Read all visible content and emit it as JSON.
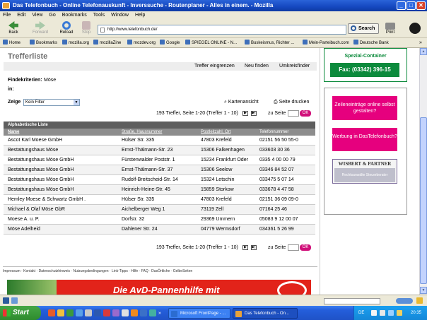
{
  "window": {
    "title": "Das Telefonbuch - Online Telefonauskunft - Inverssuche - Routenplaner - Alles in einem. - Mozilla",
    "min": "_",
    "max": "□",
    "close": "✕"
  },
  "menu": [
    "File",
    "Edit",
    "View",
    "Go",
    "Bookmarks",
    "Tools",
    "Window",
    "Help"
  ],
  "toolbar": {
    "back": "Back",
    "forward": "Forward",
    "reload": "Reload",
    "stop": "Stop",
    "url": "http://www.telefonbuch.de/",
    "search": "Search",
    "print": "Print"
  },
  "bookmarks": [
    "Home",
    "Bookmarks",
    "mozilla.org",
    "mozillaZine",
    "mozdev.org",
    "Google",
    "SPIEGEL ONLINE - N...",
    "Buskeismus, Richter ...",
    "Mein-Parteibuch.com",
    "Deutsche Bank"
  ],
  "page": {
    "heading": "Trefferliste",
    "actions": [
      "Treffer eingrenzen",
      "Neu finden",
      "Umkreisfinder"
    ],
    "criteria_label": "Findekriterien:",
    "criteria_value": "Möse",
    "criteria_in": "in:",
    "zeige_label": "Zeige",
    "filter_value": "Kein Filter",
    "map_view": "Kartenansicht",
    "print_page": "Seite drucken",
    "pager_top": "193 Treffer, Seite 1-20 (Treffer 1 - 10)",
    "pager_bottom": "193 Treffer, Seite 1-20 (Treffer 1 - 10)",
    "goto_label": "zu Seite",
    "ok": "OK",
    "list_title": "Alphabetische Liste",
    "columns": [
      "Name",
      "Straße, Hausnummer",
      "Postleitzahl, Ort",
      "Telefonnummer"
    ],
    "rows": [
      [
        "Ascot Karl Moese GmbH",
        "Hülser Str. 335",
        "47803 Krefeld",
        "02151 56 50 55-0"
      ],
      [
        "Bestattungshaus Möse",
        "Ernst-Thälmann-Str. 23",
        "15306 Falkenhagen",
        "033603 30 36"
      ],
      [
        "Bestattungshaus Möse GmbH",
        "Fürstenwalder Poststr. 1",
        "15234 Frankfurt Oder",
        "0335 4 00 00 79"
      ],
      [
        "Bestattungshaus Möse GmbH",
        "Ernst-Thälmann-Str. 37",
        "15306 Seelow",
        "03346 84 52 07"
      ],
      [
        "Bestattungshaus Möse GmbH",
        "Rudolf-Breitscheid-Str. 14",
        "15324 Letschin",
        "033475 5 07 14"
      ],
      [
        "Bestattungshaus Möse GmbH",
        "Heinrich-Heine-Str. 45",
        "15859 Storkow",
        "033678 4 47 58"
      ],
      [
        "Hemley Moese & Schwartz GmbH .",
        "Hülser Str. 335",
        "47803 Krefeld",
        "02151 36 09 09-0"
      ],
      [
        "Michael & Olaf Möse GbR",
        "Aichelberger Weg 1",
        "73119 Zell",
        "07164 25 46"
      ],
      [
        "Moese A. u. P.",
        "Dorfstr. 32",
        "29369 Ummern",
        "05083 9 12 00 07"
      ],
      [
        "Möse Adelheid",
        "Dahlener Str. 24",
        "04779 Wermsdorf",
        "034361 5 26 99"
      ]
    ],
    "footer_links": "Impressum · Kontakt · Datenschutzhinweis · Nutzungsbedingungen · Link-Tipps · Hilfe · FAQ · DasÖrtliche · GelbeSeiten",
    "banner_text": "Die AvD-Pannenhilfe mit"
  },
  "ads": {
    "container_title": "Spezial-Container",
    "container_fax": "Fax: (03342) 396-15",
    "ad1": "Zeileneinträge online selbst gestalten?",
    "ad2": "Werbung in DasTelefonbuch?",
    "wisbert": "WISBERT & PARTNER",
    "wisbert_sub": "Rechtsanwälte Steuerberater"
  },
  "taskbar": {
    "start": "Start",
    "tasks": [
      "Microsoft FrontPage - ...",
      "Das Telefonbuch - On..."
    ],
    "lang": "DE",
    "time": "20:35"
  },
  "colors": {
    "accent": "#e6007e",
    "header_gray": "#5e5e5e",
    "fax_green": "#0c8a3c"
  }
}
